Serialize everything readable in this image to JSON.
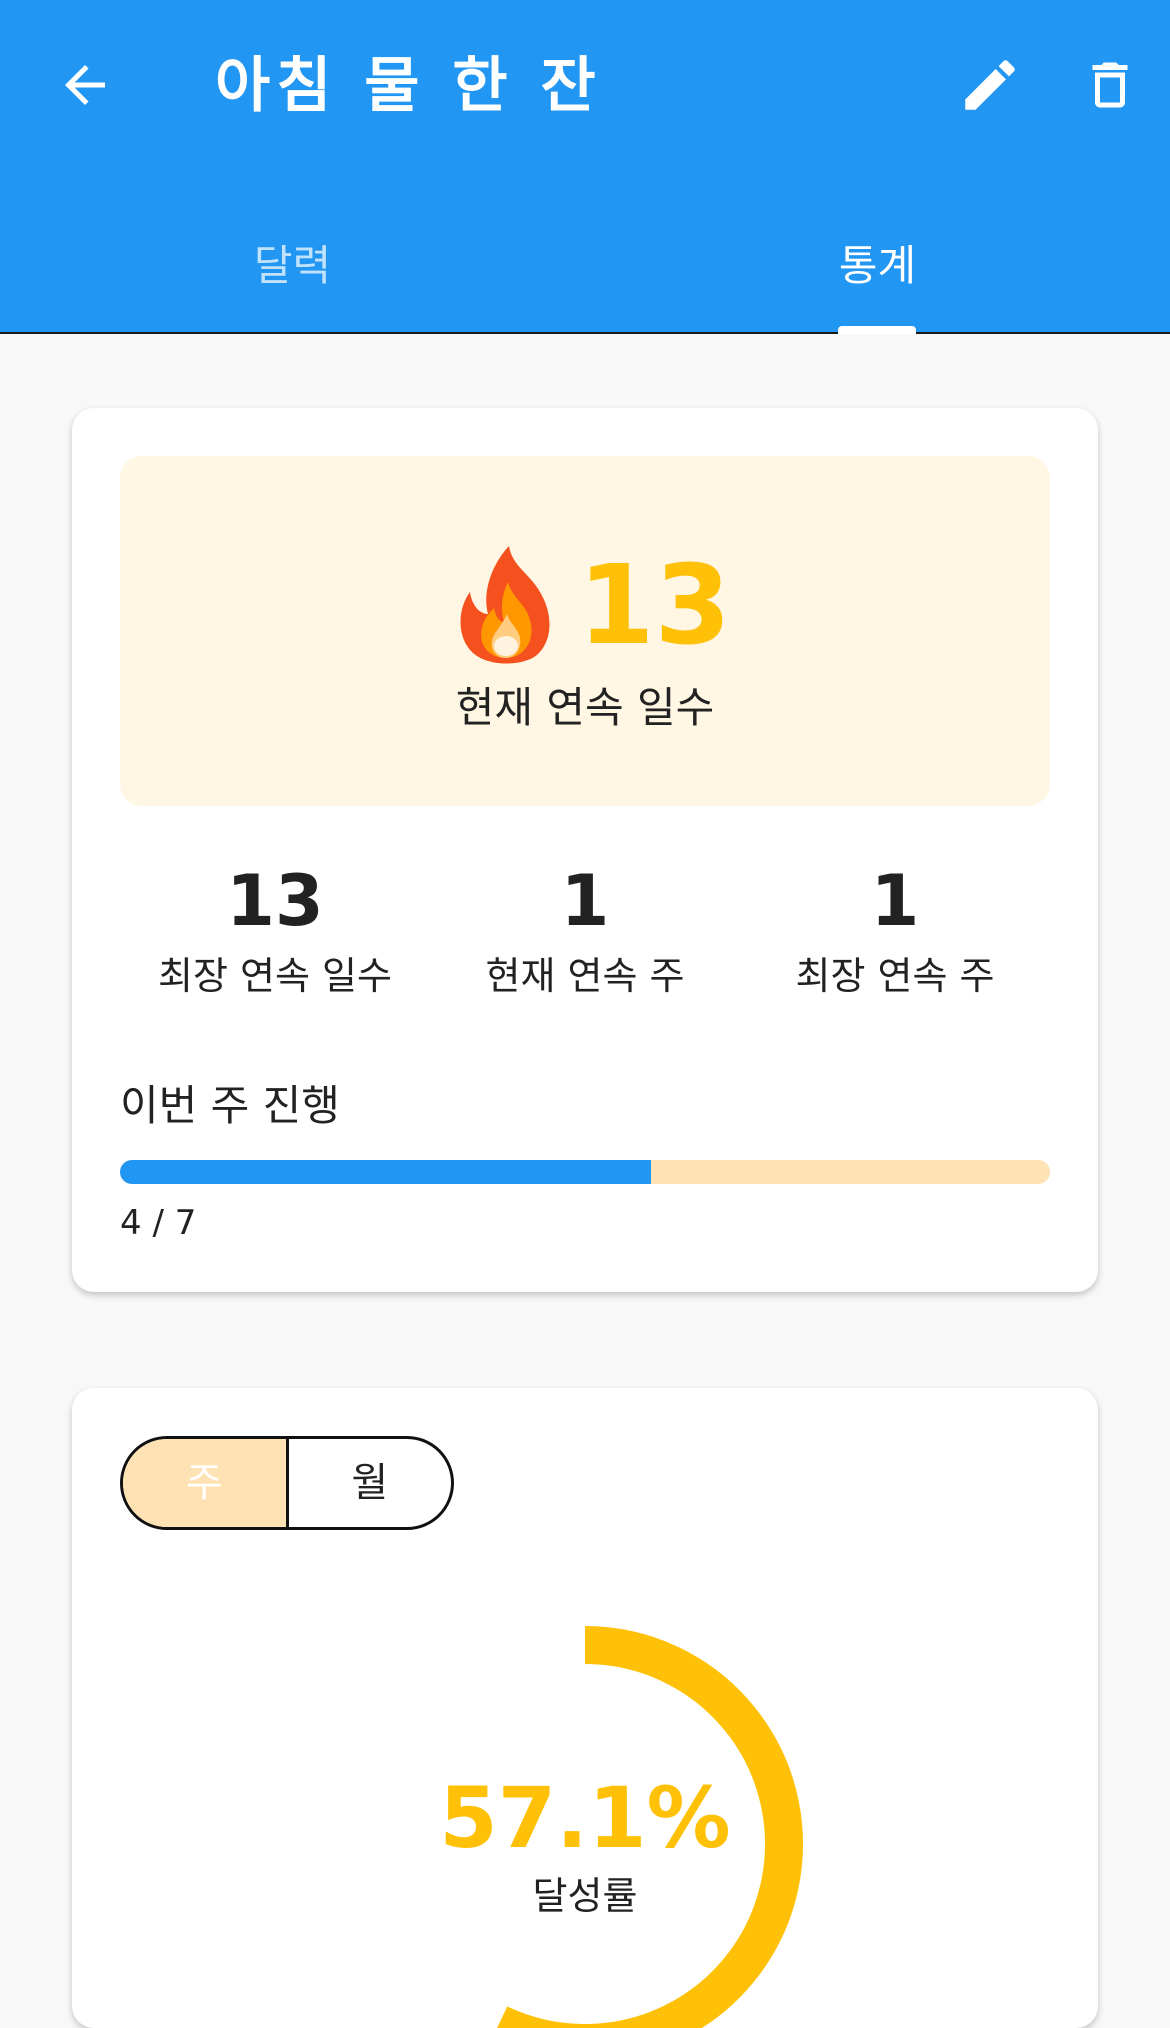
{
  "header": {
    "title": "아침 물 한 잔",
    "back_icon": "arrow-left-icon",
    "edit_icon": "pencil-icon",
    "delete_icon": "trash-icon"
  },
  "tabs": [
    {
      "label": "달력",
      "selected": false
    },
    {
      "label": "통계",
      "selected": true
    }
  ],
  "streak_card": {
    "current_streak_value": "13",
    "current_streak_label": "현재 연속 일수",
    "flame_icon": "fire-icon",
    "stats": [
      {
        "value": "13",
        "label": "최장 연속 일수"
      },
      {
        "value": "1",
        "label": "현재 연속 주"
      },
      {
        "value": "1",
        "label": "최장 연속 주"
      }
    ],
    "week_progress": {
      "title": "이번 주 진행",
      "done": 4,
      "total": 7,
      "text": "4 / 7"
    }
  },
  "rate_card": {
    "toggle": [
      {
        "label": "주",
        "selected": true
      },
      {
        "label": "월",
        "selected": false
      }
    ],
    "rate_text": "57.1%",
    "rate_fraction": 0.571,
    "rate_label": "달성률"
  },
  "colors": {
    "primary": "#2196f3",
    "accent": "#ffc107",
    "hero_bg": "#fff7e3",
    "track": "#ffe2b3"
  }
}
